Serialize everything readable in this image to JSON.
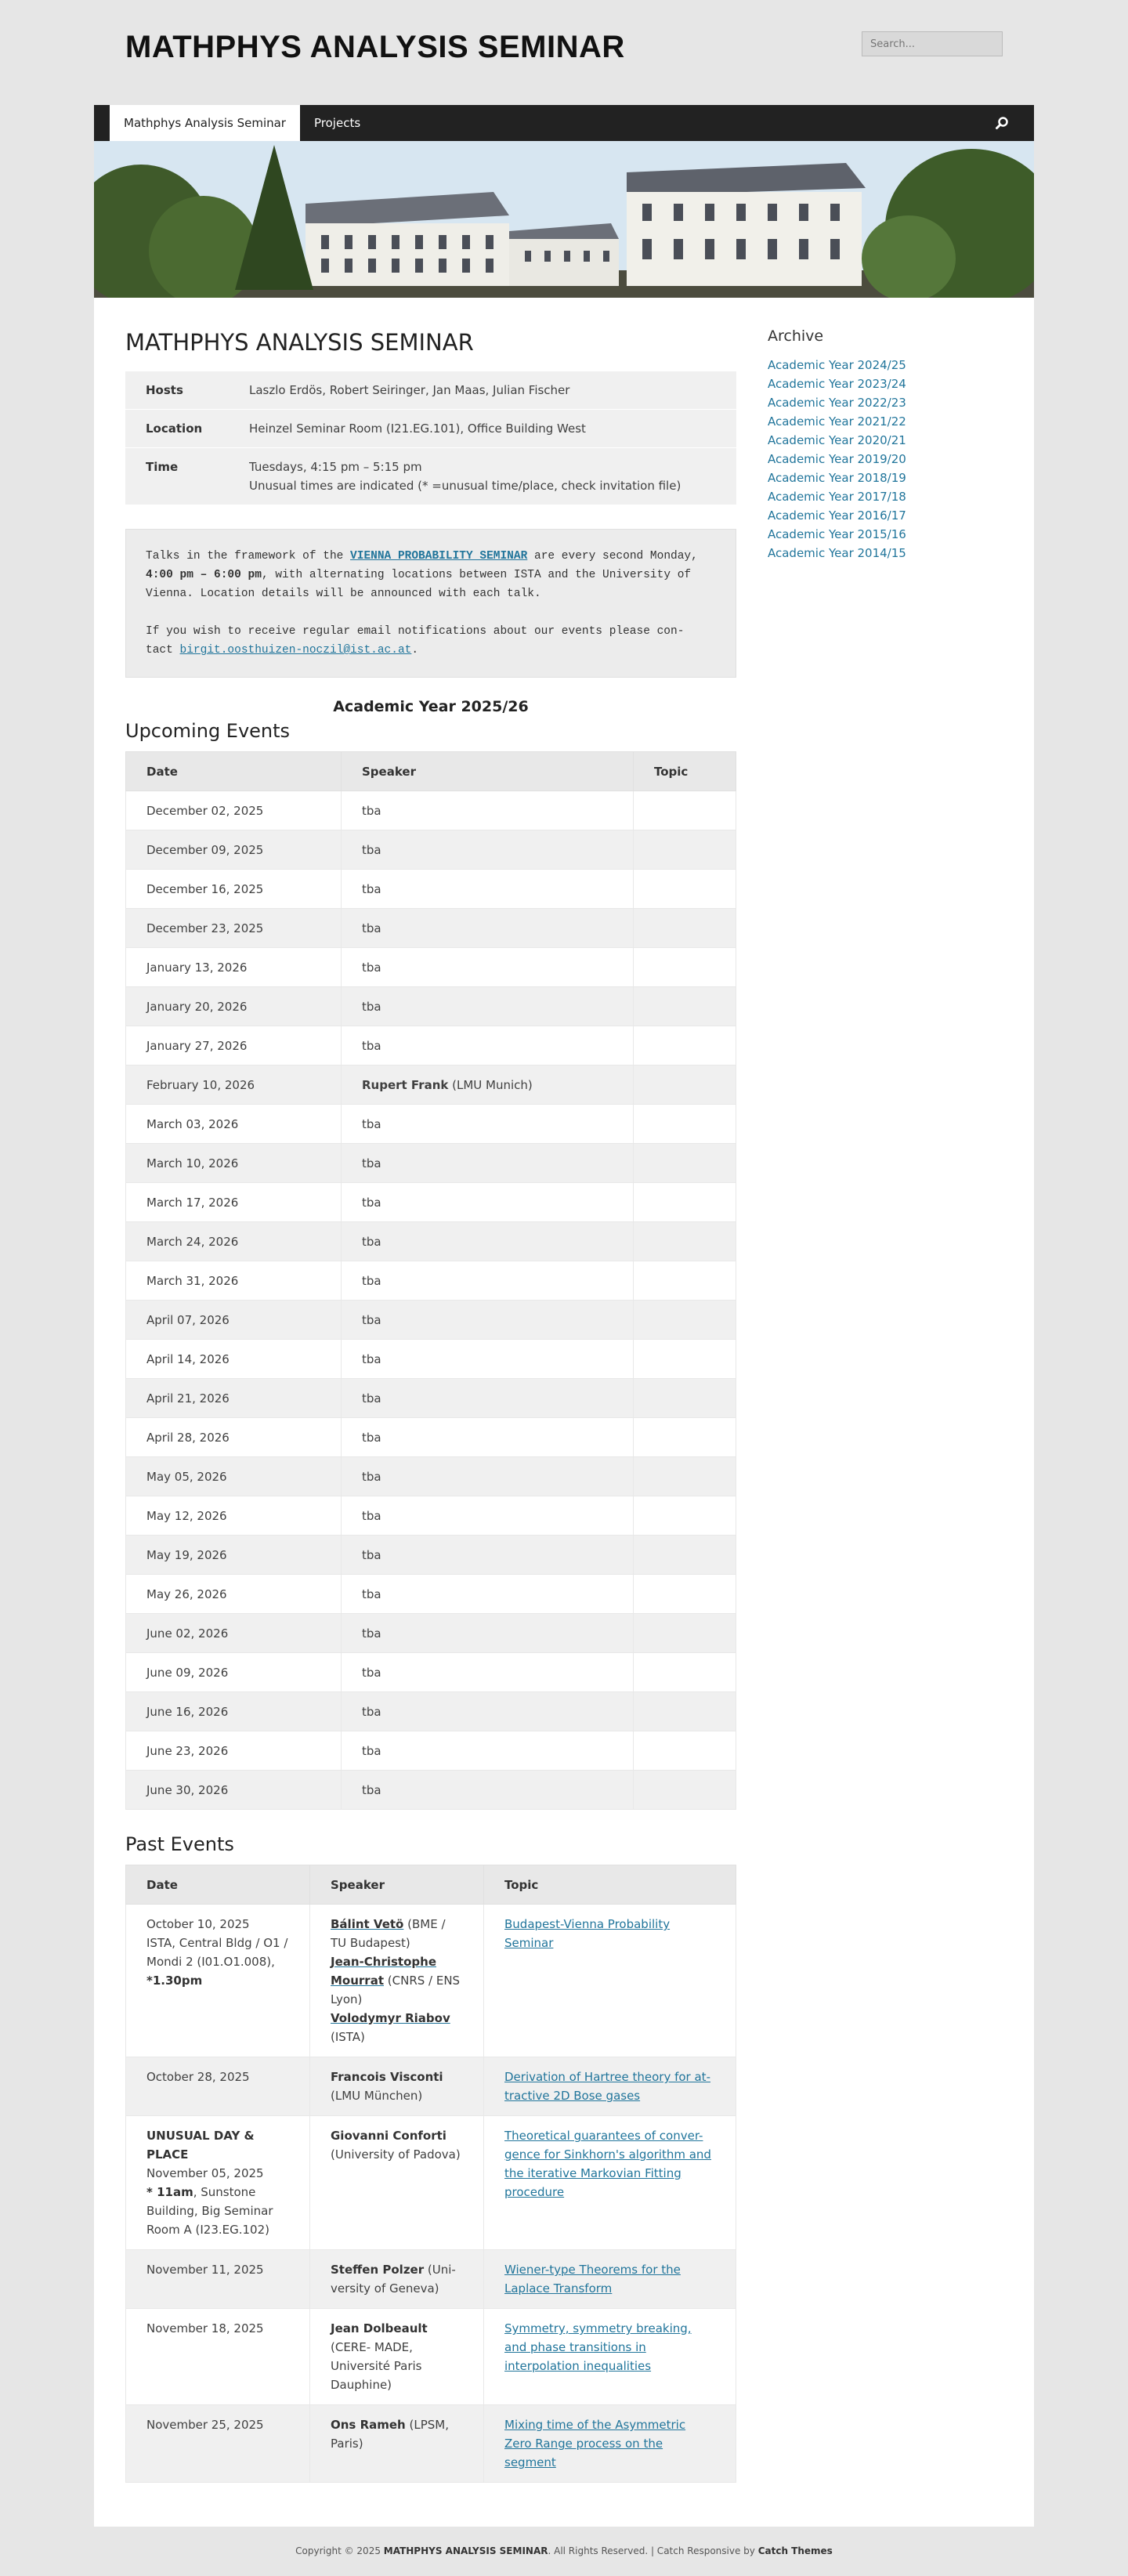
{
  "site": {
    "title": "MATHPHYS ANALYSIS SEMINAR",
    "search_placeholder": "Search..."
  },
  "nav": {
    "items": [
      {
        "label": "Mathphys Analysis Seminar"
      },
      {
        "label": "Projects"
      }
    ]
  },
  "page": {
    "title": "MATHPHYS ANALYSIS SEMINAR",
    "info": {
      "hosts_label": "Hosts",
      "hosts_value": "Laszlo Erdös, Robert Seiringer, Jan Maas, Julian Fischer",
      "location_label": "Location",
      "location_value": "Heinzel Seminar Room (I21.EG.101), Office Building West",
      "time_label": "Time",
      "time_value_1": "Tuesdays, 4:15 pm – 5:15 pm",
      "time_value_2": "Unusual times are indicated (* =unusual time/place, check invitation file)"
    },
    "notice": {
      "p1_a": "Talks in the framework of the ",
      "p1_link": "VIENNA PROBABILITY SEMINAR",
      "p1_b": " are every second Monday, ",
      "p1_bold": "4:00 pm – 6:00 pm",
      "p1_c": ", with alternating locations  between ISTA and the University of Vienna. Location details will  be announced with each talk.",
      "p2_a": "If you wish to receive regular email notifications about our events please con- tact ",
      "p2_link": "birgit.oosthuizen-noczil@ist.ac.at",
      "p2_b": "."
    },
    "year_heading": "Academic Year 2025/26",
    "upcoming_heading": "Upcoming Events",
    "past_heading": "Past Events"
  },
  "upcoming": {
    "headers": {
      "date": "Date",
      "speaker": "Speaker",
      "topic": "Topic"
    },
    "rows": [
      {
        "date": "December 02, 2025",
        "speaker": "tba"
      },
      {
        "date": "December 09, 2025",
        "speaker": "tba"
      },
      {
        "date": "December 16, 2025",
        "speaker": "tba"
      },
      {
        "date": "December 23, 2025",
        "speaker": "tba"
      },
      {
        "date": "January 13, 2026",
        "speaker": "tba"
      },
      {
        "date": "January 20, 2026",
        "speaker": "tba"
      },
      {
        "date": "January 27, 2026",
        "speaker": "tba"
      },
      {
        "date": "February 10, 2026",
        "speaker_bold": "Rupert Frank",
        "speaker_rest": " (LMU Munich)"
      },
      {
        "date": "March 03, 2026",
        "speaker": "tba"
      },
      {
        "date": "March 10, 2026",
        "speaker": "tba"
      },
      {
        "date": "March 17, 2026",
        "speaker": "tba"
      },
      {
        "date": "March 24, 2026",
        "speaker": "tba"
      },
      {
        "date": "March 31, 2026",
        "speaker": "tba"
      },
      {
        "date": "April 07, 2026",
        "speaker": "tba"
      },
      {
        "date": "April 14, 2026",
        "speaker": "tba"
      },
      {
        "date": "April 21, 2026",
        "speaker": "tba"
      },
      {
        "date": "April 28, 2026",
        "speaker": "tba"
      },
      {
        "date": "May 05, 2026",
        "speaker": "tba"
      },
      {
        "date": "May 12, 2026",
        "speaker": "tba"
      },
      {
        "date": "May 19, 2026",
        "speaker": "tba"
      },
      {
        "date": "May 26, 2026",
        "speaker": "tba"
      },
      {
        "date": "June 02, 2026",
        "speaker": "tba"
      },
      {
        "date": "June 09, 2026",
        "speaker": "tba"
      },
      {
        "date": "June 16, 2026",
        "speaker": "tba"
      },
      {
        "date": "June 23, 2026",
        "speaker": "tba"
      },
      {
        "date": "June 30, 2026",
        "speaker": "tba"
      }
    ]
  },
  "past": {
    "headers": {
      "date": "Date",
      "speaker": "Speaker",
      "topic": "Topic"
    },
    "rows": [
      {
        "date_lines": [
          "October 10, 2025",
          "ISTA, Central Bldg / O1 / Mondi 2 (I01.O1.008),"
        ],
        "date_bold": "*1.30pm",
        "speakers": [
          {
            "name": "Bálint Vetö",
            "link": true,
            "rest": " (BME / TU Budapest)"
          },
          {
            "name": "Jean-Christophe Mourrat",
            "link": true,
            "rest": " (CNRS / ENS Lyon)"
          },
          {
            "name": "Volodymyr Riabov",
            "link": true,
            "rest": " (ISTA)"
          }
        ],
        "topic": "Budapest-Vienna Probability Seminar"
      },
      {
        "date_lines": [
          "October 28, 2025"
        ],
        "speakers": [
          {
            "name": "Francois Visconti",
            "rest": " (LMU München)"
          }
        ],
        "topic": "Derivation of Hartree theory for at- tractive 2D Bose gases"
      },
      {
        "date_bold_top": "UNUSUAL DAY & PLACE",
        "date_lines": [
          "November 05, 2025"
        ],
        "date_bold": "* 11am",
        "date_tail": ", Sunstone Building, Big Seminar Room A (I23.EG.102)",
        "speakers": [
          {
            "name": "Giovanni Conforti",
            "rest": " (University of Padova)"
          }
        ],
        "topic": "Theoretical guarantees of conver- gence for Sinkhorn's algorithm and the iterative Markovian Fitting procedure"
      },
      {
        "date_lines": [
          "November 11, 2025"
        ],
        "speakers": [
          {
            "name": "Steffen Polzer",
            "rest": " (Uni- versity of Geneva)"
          }
        ],
        "topic": "Wiener-type Theorems for the Laplace Transform"
      },
      {
        "date_lines": [
          "November 18, 2025"
        ],
        "speakers": [
          {
            "name": "Jean Dolbeault",
            "rest": " (CERE- MADE, Université Paris Dauphine)"
          }
        ],
        "topic": "Symmetry, symmetry breaking, and phase transitions in interpolation inequalities"
      },
      {
        "date_lines": [
          "November 25, 2025"
        ],
        "speakers": [
          {
            "name": "Ons Rameh",
            "rest": " (LPSM, Paris)"
          }
        ],
        "topic": "Mixing time of the Asymmetric Zero Range process on the segment"
      }
    ]
  },
  "sidebar": {
    "archive_title": "Archive",
    "archive_items": [
      "Academic Year 2024/25",
      "Academic Year 2023/24",
      "Academic Year 2022/23",
      "Academic Year 2021/22",
      "Academic Year 2020/21",
      "Academic Year 2019/20",
      "Academic Year 2018/19",
      "Academic Year 2017/18",
      "Academic Year 2016/17",
      "Academic Year 2015/16",
      "Academic Year 2014/15"
    ]
  },
  "footer": {
    "prefix": "Copyright © 2025 ",
    "site": "MATHPHYS ANALYSIS SEMINAR",
    "middle": ". All Rights Reserved. | Catch Responsive by ",
    "theme": "Catch Themes"
  },
  "icons": {
    "search": "search-icon"
  },
  "colors": {
    "link": "#21759b",
    "nav_bg": "#222222"
  }
}
